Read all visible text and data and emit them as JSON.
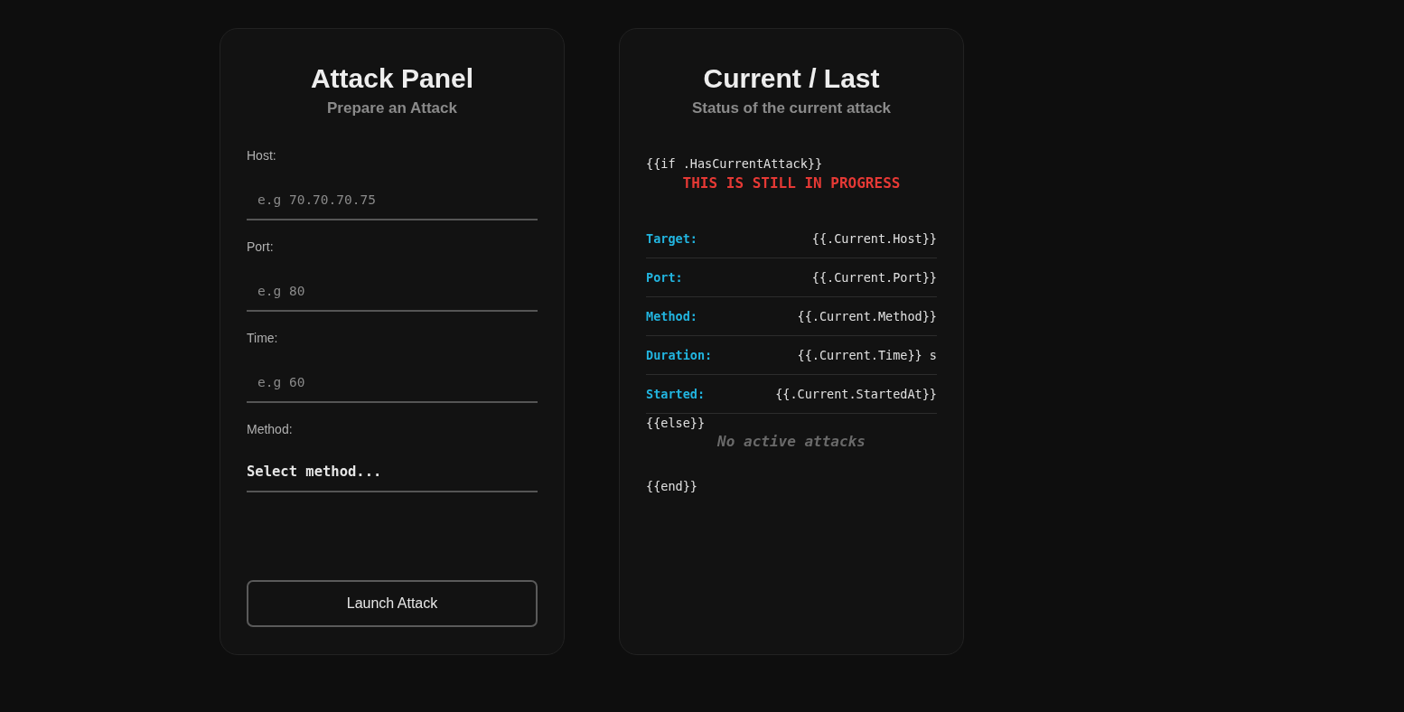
{
  "attack_panel": {
    "title": "Attack Panel",
    "subtitle": "Prepare an Attack",
    "fields": [
      {
        "kind": "input",
        "label": "Host:",
        "placeholder": "e.g 70.70.70.75"
      },
      {
        "kind": "input",
        "label": "Port:",
        "placeholder": "e.g 80"
      },
      {
        "kind": "input",
        "label": "Time:",
        "placeholder": "e.g 60"
      },
      {
        "kind": "select",
        "label": "Method:",
        "value": "Select method..."
      }
    ],
    "button": "Launch Attack"
  },
  "status_panel": {
    "title": "Current / Last",
    "subtitle": "Status of the current attack",
    "if_line": "{{if .HasCurrentAttack}}",
    "progress_message": "THIS IS STILL IN PROGRESS",
    "rows": [
      {
        "label": "Target:",
        "value": "{{.Current.Host}}"
      },
      {
        "label": "Port:",
        "value": "{{.Current.Port}}"
      },
      {
        "label": "Method:",
        "value": "{{.Current.Method}}"
      },
      {
        "label": "Duration:",
        "value": "{{.Current.Time}} s"
      },
      {
        "label": "Started:",
        "value": "{{.Current.StartedAt}}"
      }
    ],
    "else_line": "{{else}}",
    "empty_message": "No active attacks",
    "end_line": "{{end}}"
  }
}
